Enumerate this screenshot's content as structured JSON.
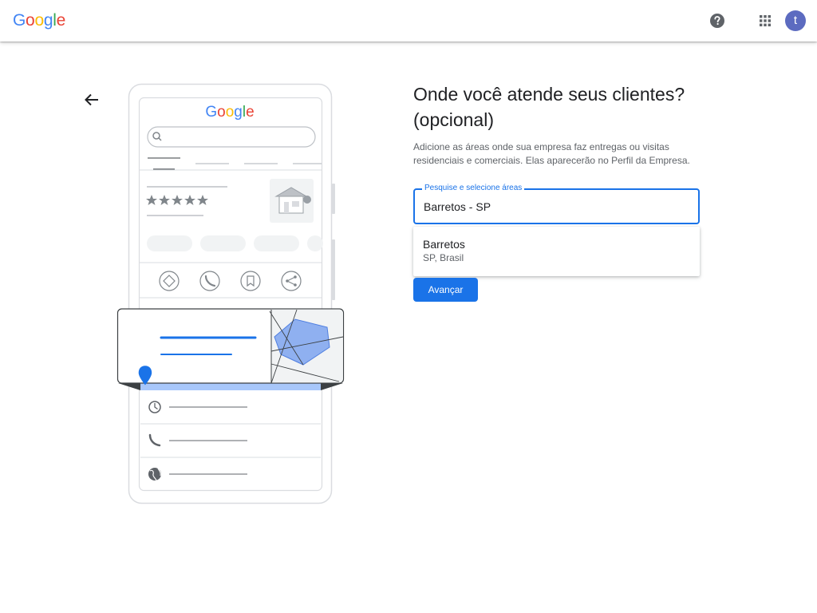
{
  "header": {
    "logo_letters": [
      "G",
      "o",
      "o",
      "g",
      "l",
      "e"
    ],
    "logo_colors": [
      "#4285F4",
      "#EA4335",
      "#FBBC05",
      "#4285F4",
      "#34A853",
      "#EA4335"
    ],
    "help_icon": "help-circle-icon",
    "apps_icon": "apps-grid-icon",
    "avatar_letter": "t"
  },
  "nav": {
    "back_icon": "arrow-back-icon"
  },
  "illustration": {
    "phone_logo": "Google",
    "accent_color": "#4285F4",
    "map_polygon_color": "#8fb0f0"
  },
  "main": {
    "title": "Onde você atende seus clientes? (opcional)",
    "description": "Adicione as áreas onde sua empresa faz entregas ou visitas residenciais e comerciais. Elas aparecerão no Perfil da Empresa.",
    "field_label": "Pesquise e selecione áreas",
    "field_value": "Barretos - SP",
    "suggestion": {
      "main": "Barretos",
      "secondary": "SP, Brasil"
    },
    "next_button": "Avançar"
  },
  "colors": {
    "primary": "#1a73e8",
    "text": "#202124",
    "muted": "#5f6368"
  }
}
